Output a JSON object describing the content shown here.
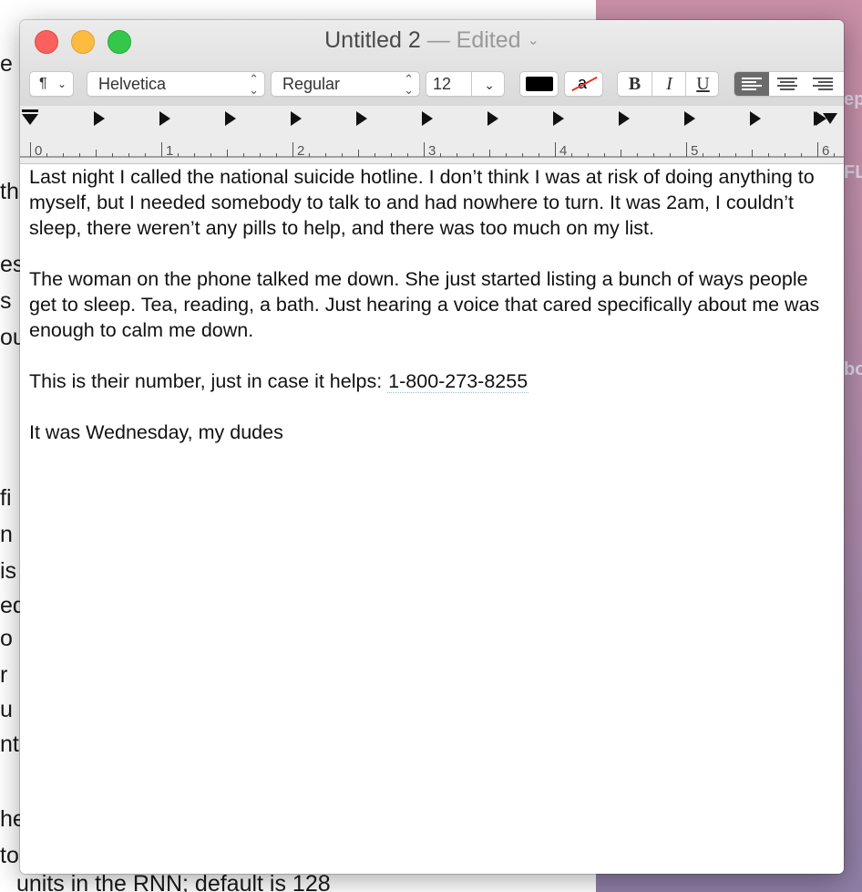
{
  "window": {
    "title": "Untitled 2",
    "title_separator": "—",
    "status": "Edited"
  },
  "toolbar": {
    "paragraph_style_symbol": "¶",
    "font_family": "Helvetica",
    "font_style": "Regular",
    "font_size": "12",
    "text_color": "#000000",
    "background_color_glyph": "a",
    "bold_label": "B",
    "italic_label": "I",
    "underline_label": "U",
    "selected_alignment": "left"
  },
  "ruler": {
    "labels": [
      "0",
      "1",
      "2",
      "3",
      "4",
      "5",
      "6"
    ]
  },
  "document": {
    "paragraphs": [
      "Last night I called the national suicide hotline. I don’t think I was at risk of doing anything to myself, but I needed somebody to talk to and had nowhere to turn. It was 2am, I couldn’t sleep, there weren’t any pills to help, and there was too much on my list.",
      "The woman on the phone talked me down. She just started listing a bunch of ways people get to sleep. Tea, reading, a bath. Just hearing a voice that cared specifically about me was enough to calm me down.",
      "This is their number, just in case it helps:",
      "It was Wednesday, my dudes"
    ],
    "phone_number": "1-800-273-8255"
  },
  "background_window": {
    "fragments": [
      "e",
      "th",
      "es",
      "s",
      "ou",
      "fi",
      "n",
      "is",
      "ed",
      "o",
      "r",
      "u",
      "nt",
      "he",
      "to",
      "units in the RNN; default is 128"
    ]
  },
  "background_right": {
    "fragments": [
      "ep",
      "FL",
      "bo"
    ]
  }
}
